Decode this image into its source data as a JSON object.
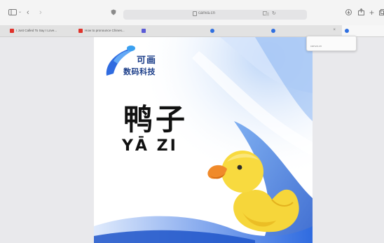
{
  "browser": {
    "url": "canva.cn",
    "tabs": [
      {
        "label": "I Just Called To Say I Love...",
        "favicon_color": "#e0322b",
        "active": false
      },
      {
        "label": "How to pronounce Chines...",
        "favicon_color": "#e0322b",
        "active": false
      },
      {
        "label": "",
        "favicon_color": "#5b5bd6",
        "active": false
      },
      {
        "label": "",
        "favicon_color": "#2f6fe0",
        "active": false
      },
      {
        "label": "",
        "favicon_color": "#2f6fe0",
        "active": false
      },
      {
        "label": "",
        "favicon_color": "#2f6fe0",
        "active": true
      }
    ],
    "tooltip": {
      "subtitle": "canva.cn"
    }
  },
  "design": {
    "logo_top": "可画",
    "logo_bottom": "数码科技",
    "word_chinese": "鸭子",
    "word_pinyin": "YĀ ZI"
  }
}
